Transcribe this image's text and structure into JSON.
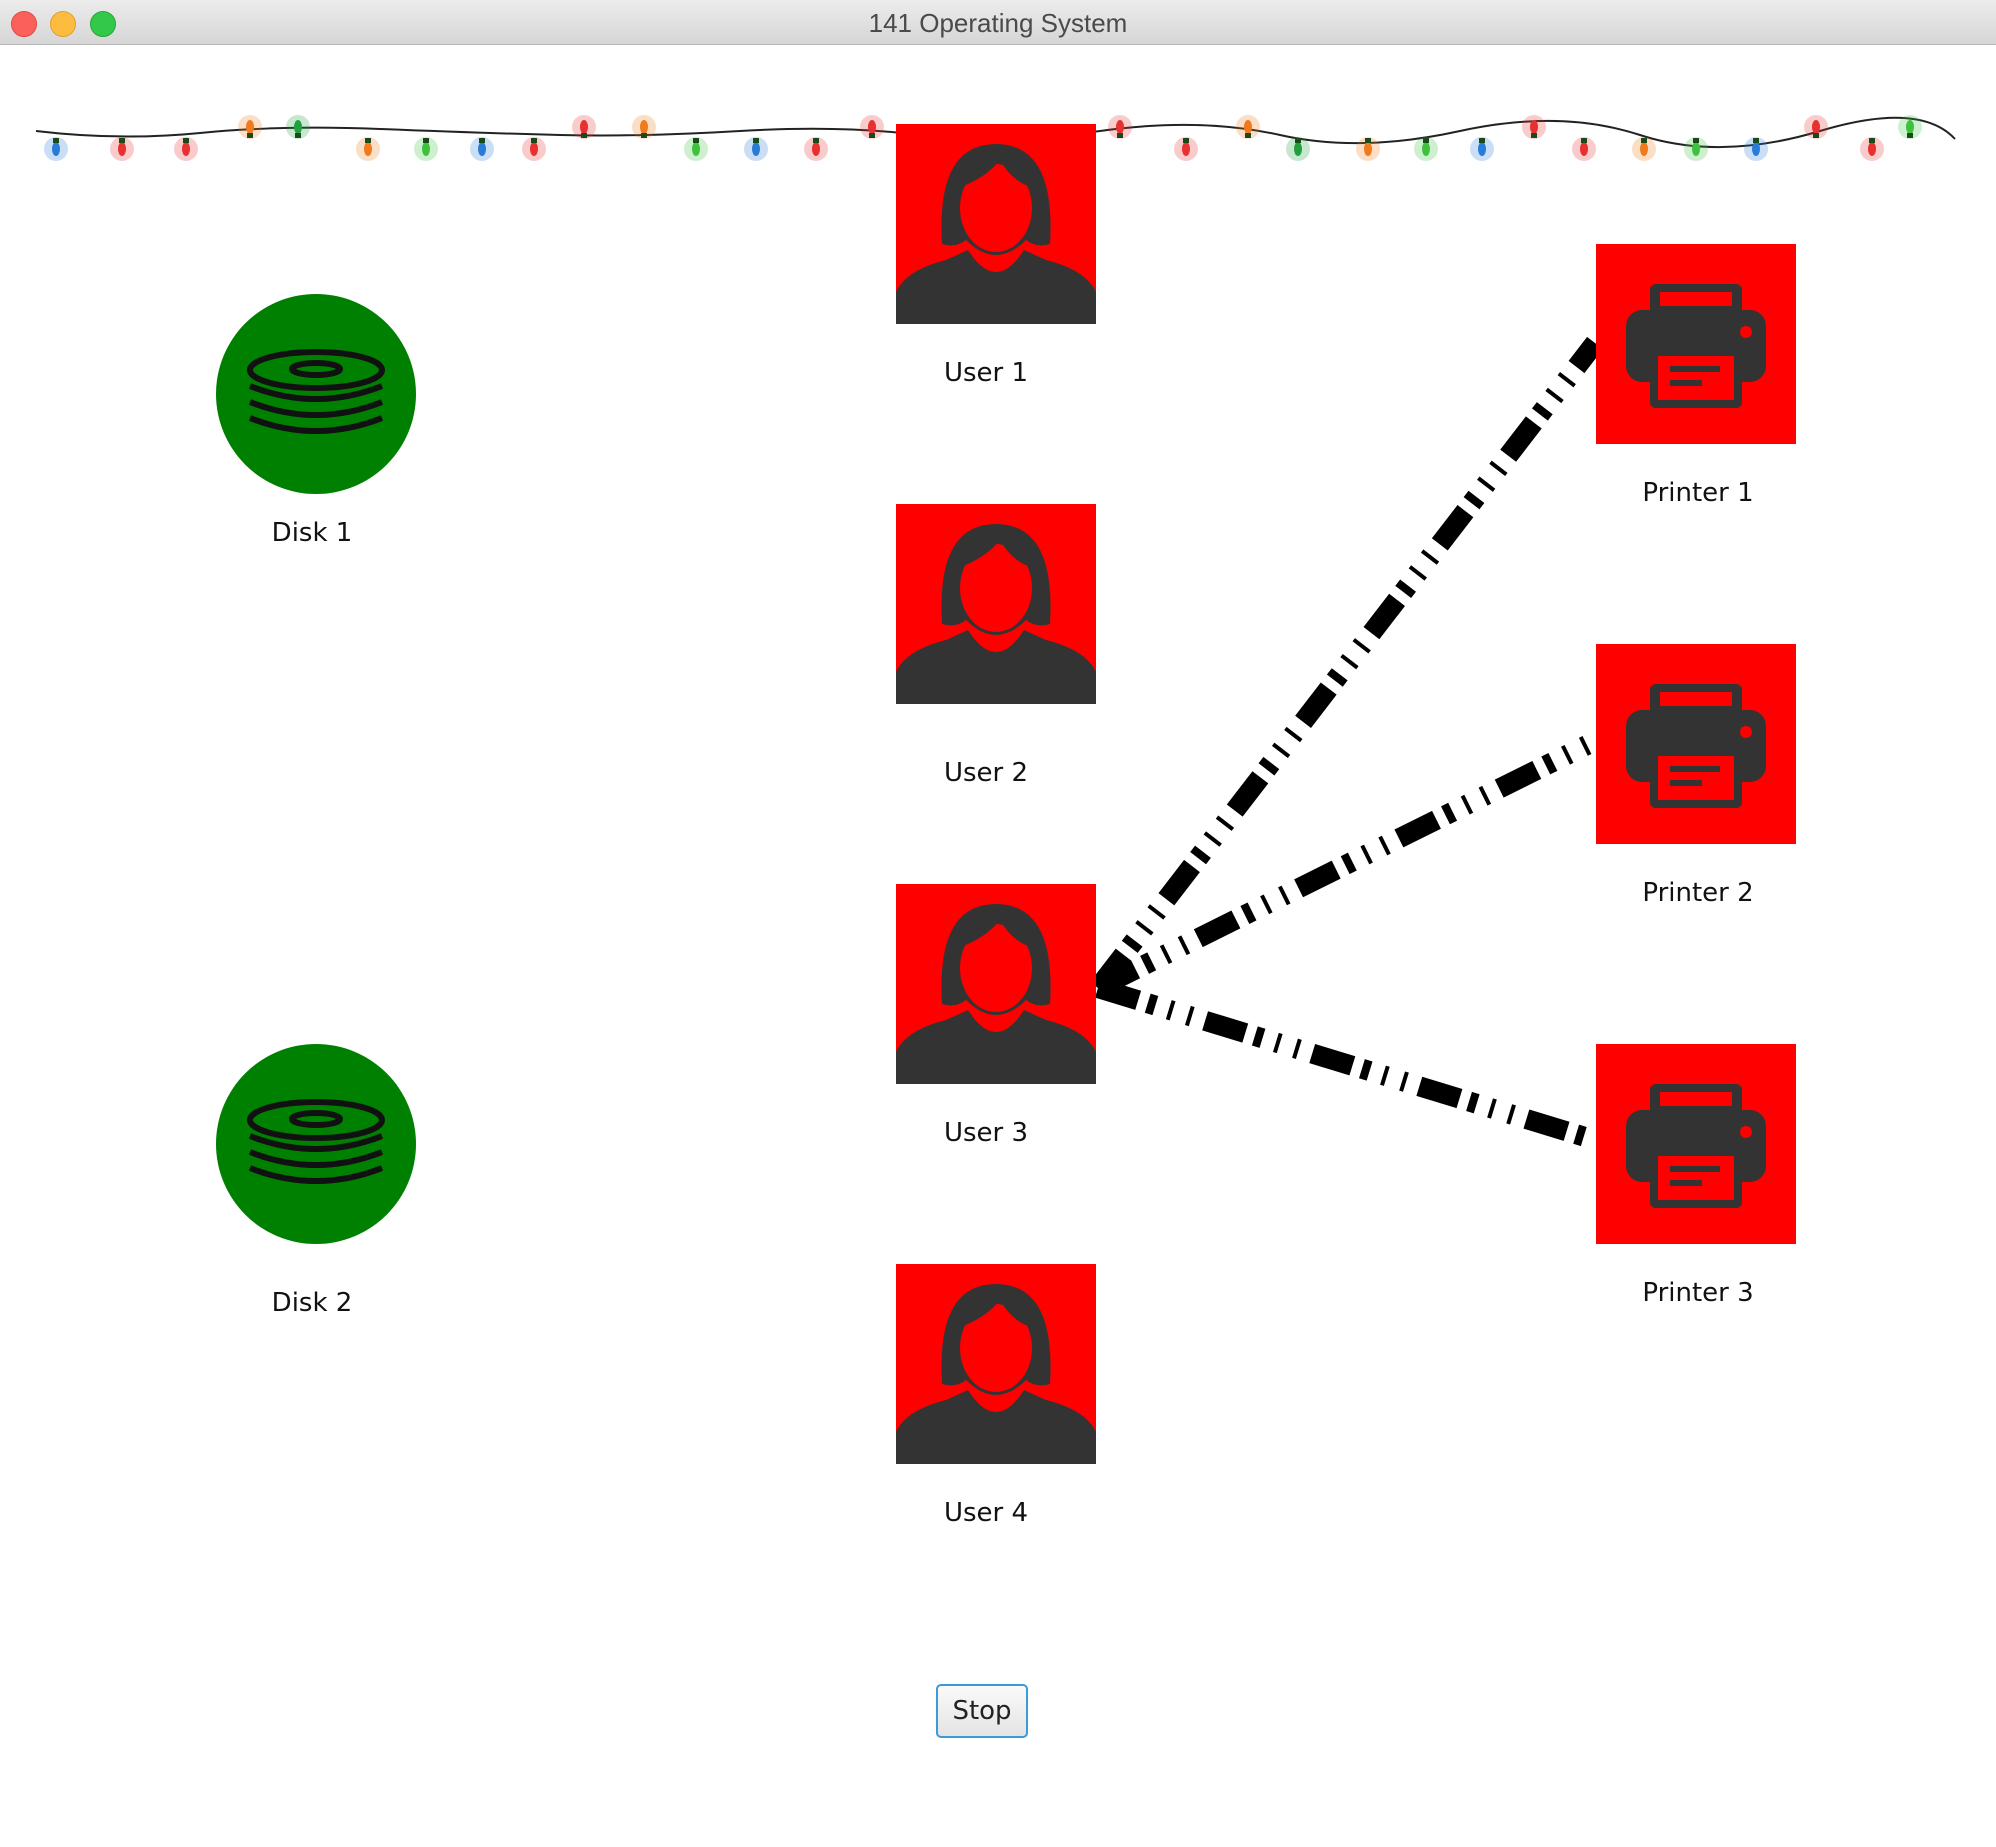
{
  "window": {
    "title": "141 Operating System"
  },
  "disks": [
    {
      "label": "Disk 1"
    },
    {
      "label": "Disk 2"
    }
  ],
  "users": [
    {
      "label": "User 1"
    },
    {
      "label": "User 2"
    },
    {
      "label": "User 3"
    },
    {
      "label": "User 4"
    }
  ],
  "printers": [
    {
      "label": "Printer 1"
    },
    {
      "label": "Printer 2"
    },
    {
      "label": "Printer 3"
    }
  ],
  "connections": [
    {
      "from": "User 3",
      "to": "Printer 1"
    },
    {
      "from": "User 3",
      "to": "Printer 2"
    },
    {
      "from": "User 3",
      "to": "Printer 3"
    }
  ],
  "controls": {
    "stop_label": "Stop"
  },
  "colors": {
    "disk_fill": "#008000",
    "device_tile": "#ff0000",
    "icon_gray": "#333333"
  }
}
